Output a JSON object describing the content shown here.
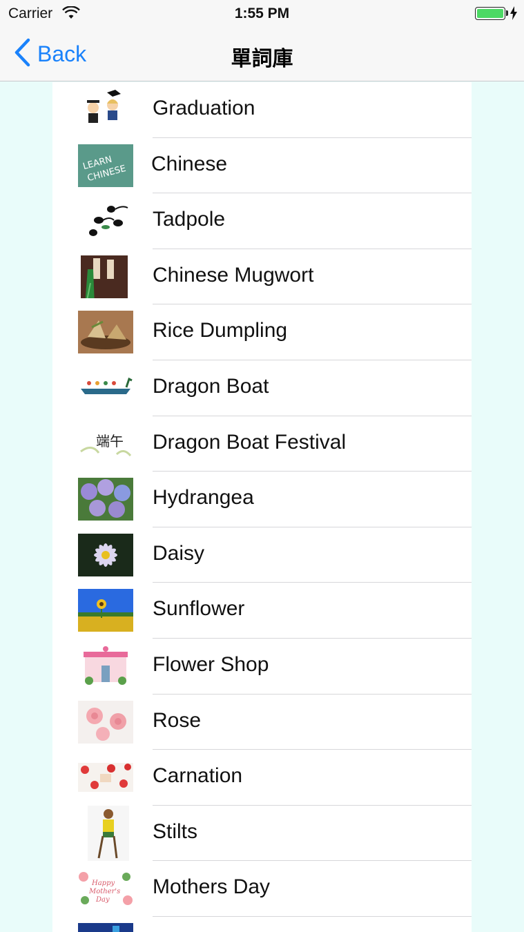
{
  "status_bar": {
    "carrier": "Carrier",
    "time": "1:55 PM",
    "battery_color": "#4cd964"
  },
  "nav": {
    "back_label": "Back",
    "title": "單詞庫",
    "accent_color": "#1a82fb"
  },
  "list": {
    "items": [
      {
        "label": "Graduation",
        "icon": "graduation-icon"
      },
      {
        "label": "Chinese",
        "icon": "learn-chinese-icon"
      },
      {
        "label": "Tadpole",
        "icon": "tadpole-icon"
      },
      {
        "label": "Chinese Mugwort",
        "icon": "mugwort-icon"
      },
      {
        "label": "Rice Dumpling",
        "icon": "rice-dumpling-icon"
      },
      {
        "label": "Dragon Boat",
        "icon": "dragon-boat-icon"
      },
      {
        "label": "Dragon Boat Festival",
        "icon": "festival-icon"
      },
      {
        "label": "Hydrangea",
        "icon": "hydrangea-icon"
      },
      {
        "label": "Daisy",
        "icon": "daisy-icon"
      },
      {
        "label": "Sunflower",
        "icon": "sunflower-icon"
      },
      {
        "label": "Flower Shop",
        "icon": "flower-shop-icon"
      },
      {
        "label": "Rose",
        "icon": "rose-icon"
      },
      {
        "label": "Carnation",
        "icon": "carnation-icon"
      },
      {
        "label": "Stilts",
        "icon": "stilts-icon"
      },
      {
        "label": "Mothers Day",
        "icon": "mothers-day-icon"
      },
      {
        "label": "",
        "icon": "partial-thumbnail-icon"
      }
    ]
  }
}
